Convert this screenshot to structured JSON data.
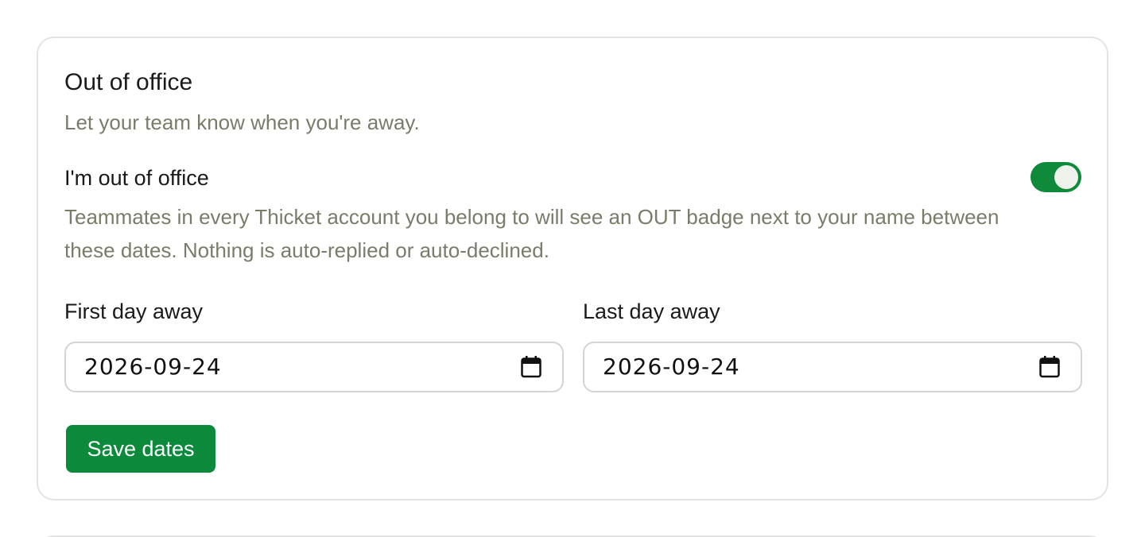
{
  "out_of_office": {
    "title": "Out of office",
    "subtitle": "Let your team know when you're away.",
    "toggle": {
      "label": "I'm out of office",
      "checked": true,
      "help_text": "Teammates in every Thicket account you belong to will see an OUT badge next to your name between these dates. Nothing is auto-replied or auto-declined."
    },
    "first_day": {
      "label": "First day away",
      "value": "2026-09-24",
      "icon": "calendar-icon"
    },
    "last_day": {
      "label": "Last day away",
      "value": "2026-09-24",
      "icon": "calendar-icon"
    },
    "save_label": "Save dates"
  },
  "colors": {
    "accent": "#0a8a3a",
    "muted_text": "#7a7c69",
    "border": "#e3e3e3"
  }
}
